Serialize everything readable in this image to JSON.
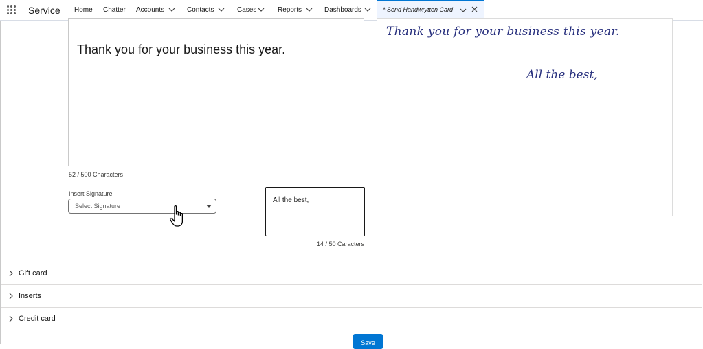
{
  "app": {
    "name": "Service"
  },
  "nav": {
    "items": [
      {
        "label": "Home"
      },
      {
        "label": "Chatter"
      },
      {
        "label": "Accounts"
      },
      {
        "label": "Contacts"
      },
      {
        "label": "Cases"
      },
      {
        "label": "Reports"
      },
      {
        "label": "Dashboards"
      }
    ],
    "active_tab": {
      "label": "* Send Handwrytten Card"
    }
  },
  "message": {
    "text": "Thank you for your business this year.",
    "char_count": "52 / 500 Characters"
  },
  "signature": {
    "label": "Insert Signature",
    "selected": "Select Signature"
  },
  "closing": {
    "text": "All the best,",
    "char_count": "14 / 50 Caracters"
  },
  "preview": {
    "body": "Thank you for your business this year.",
    "closing": "All the best,"
  },
  "sections": [
    {
      "label": "Gift card"
    },
    {
      "label": "Inserts"
    },
    {
      "label": "Credit card"
    }
  ],
  "actions": {
    "save_label": "Save"
  },
  "colors": {
    "brand": "#0176d3",
    "handwriting": "#28307e",
    "active_tab_bg": "#eef4ff"
  }
}
